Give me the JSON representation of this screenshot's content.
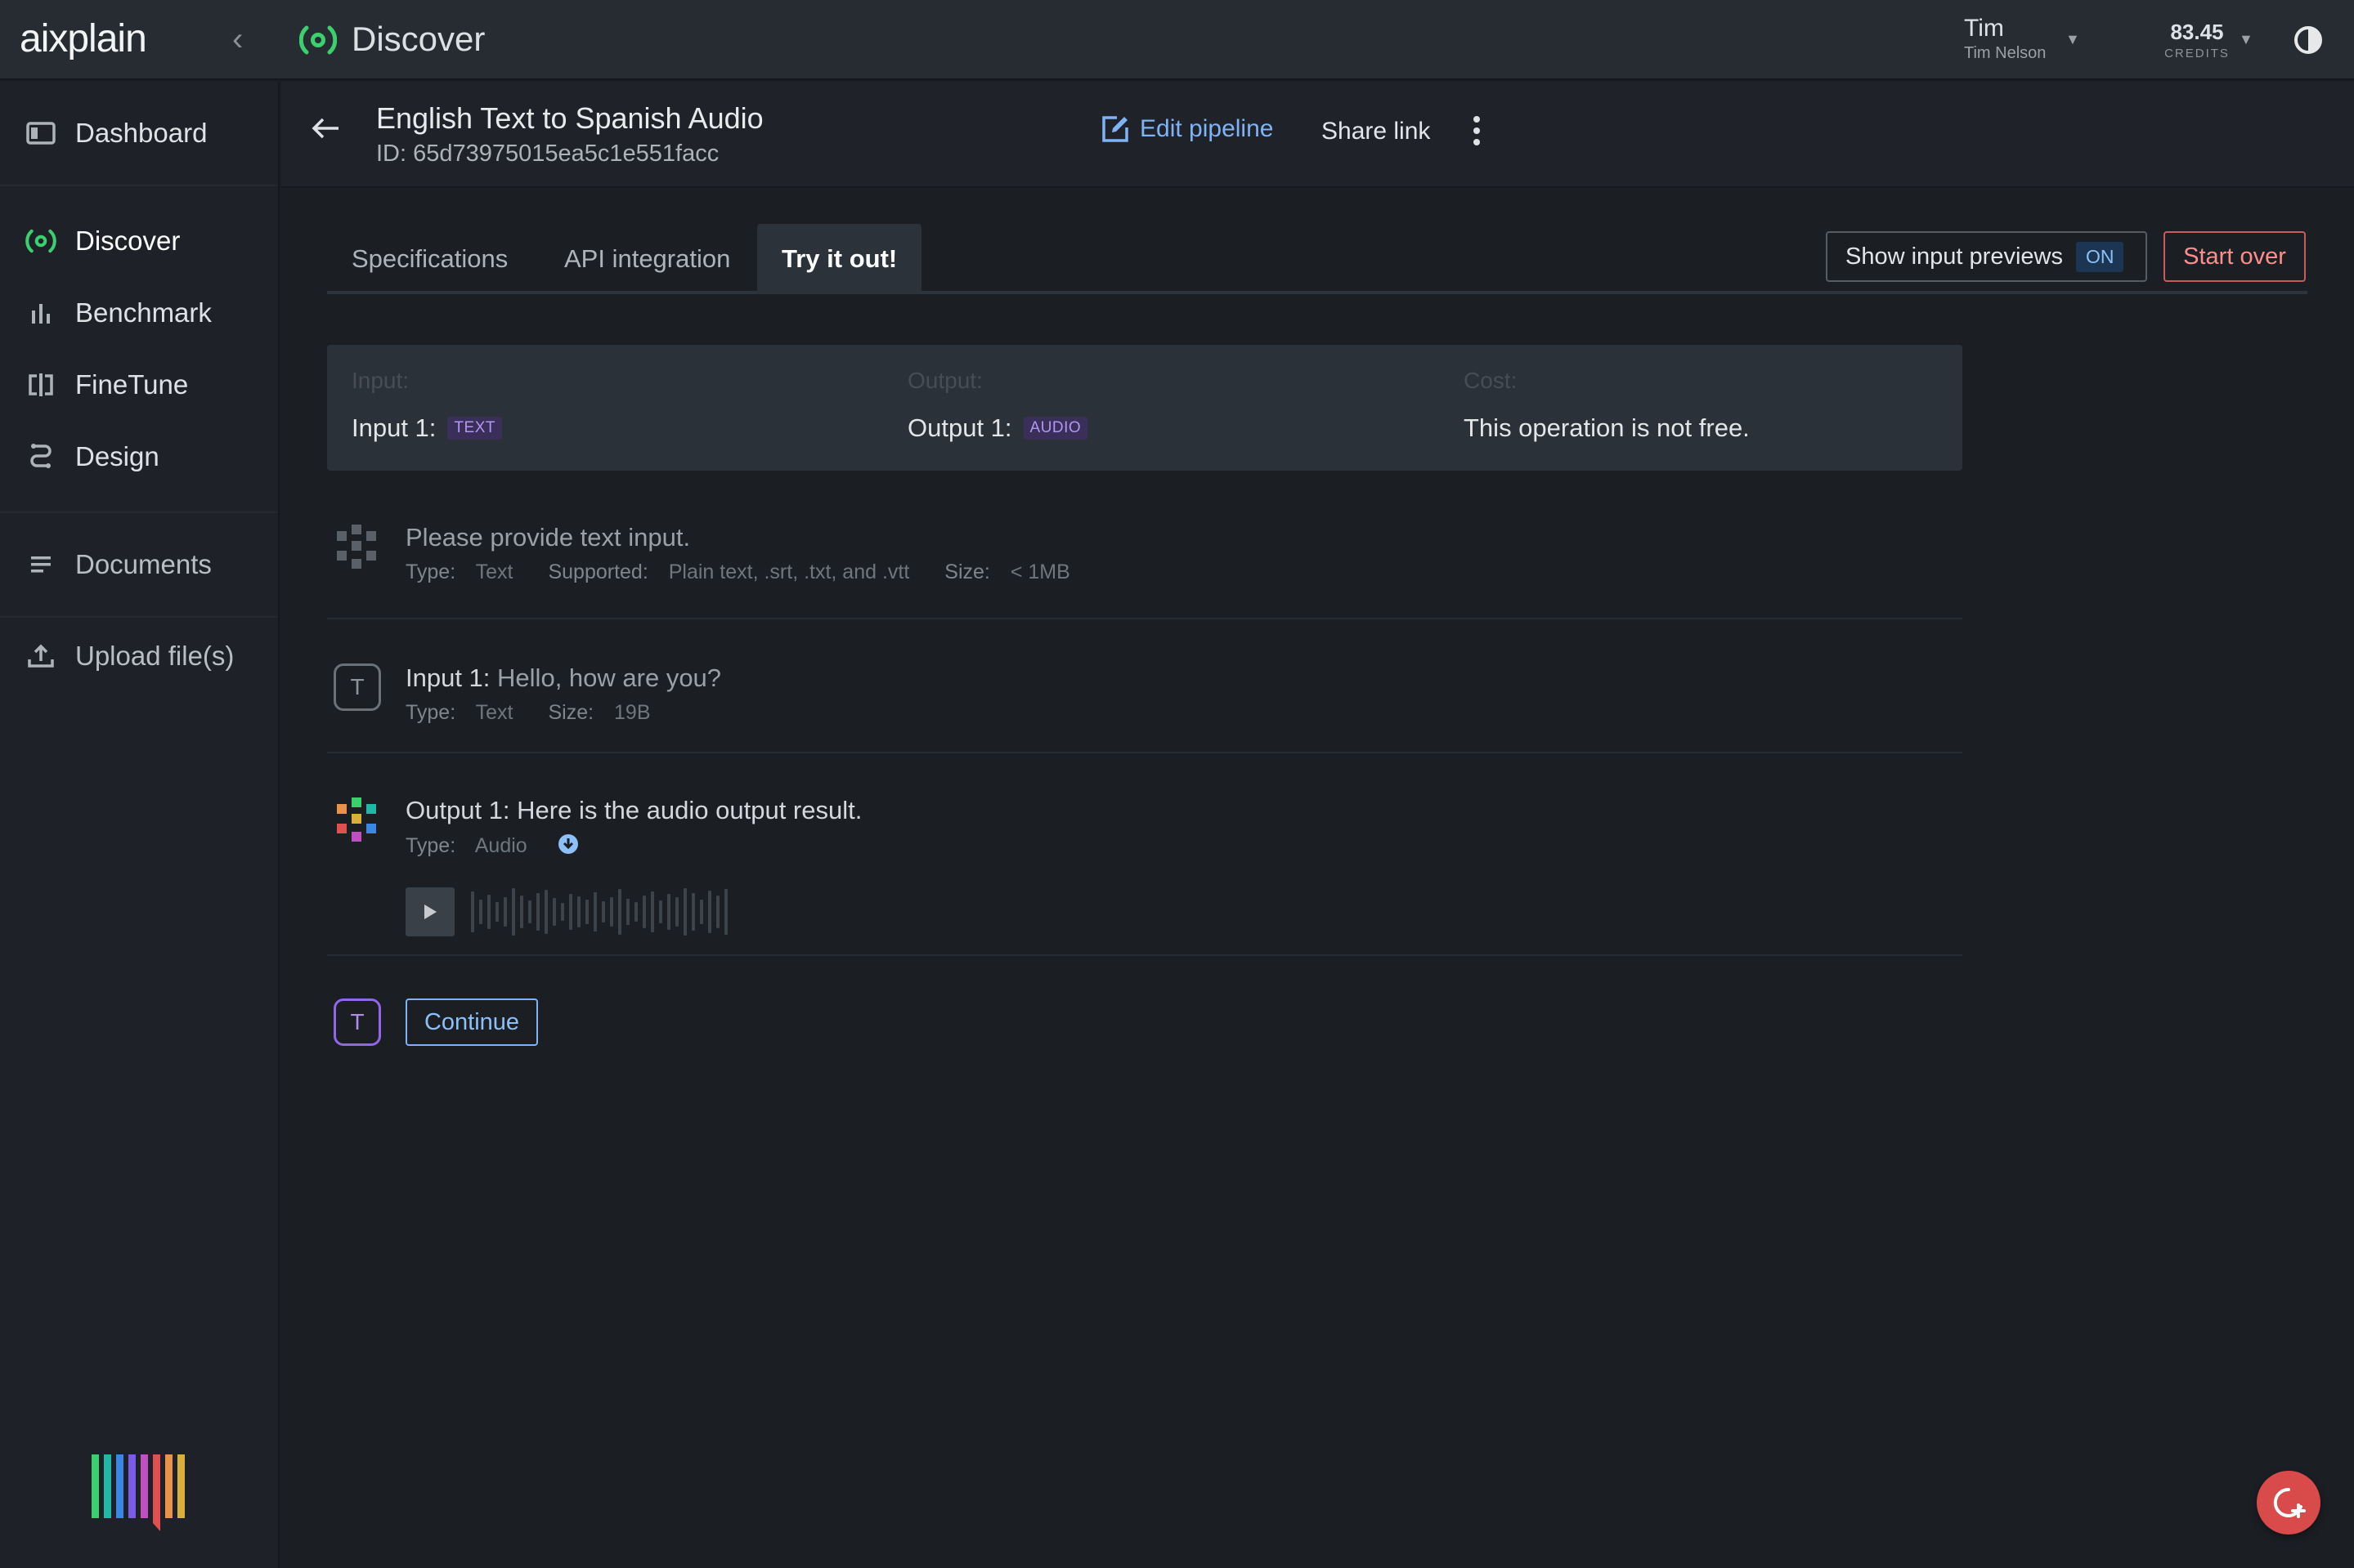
{
  "app": {
    "logo": "aixplain",
    "section_title": "Discover"
  },
  "user": {
    "name": "Tim",
    "full_name": "Tim Nelson"
  },
  "credits": {
    "value": "83.45",
    "label": "CREDITS"
  },
  "sidebar": {
    "items": [
      {
        "label": "Dashboard",
        "icon": "dashboard-icon"
      },
      {
        "label": "Discover",
        "icon": "discover-icon",
        "active": true
      },
      {
        "label": "Benchmark",
        "icon": "bar-chart-icon"
      },
      {
        "label": "FineTune",
        "icon": "finetune-icon"
      },
      {
        "label": "Design",
        "icon": "design-icon"
      },
      {
        "label": "Documents",
        "icon": "documents-icon"
      },
      {
        "label": "Upload file(s)",
        "icon": "upload-icon"
      }
    ]
  },
  "pipeline": {
    "title": "English Text to Spanish Audio",
    "id_text": "ID: 65d73975015ea5c1e551facc",
    "edit_label": "Edit pipeline",
    "share_label": "Share link"
  },
  "tabs": [
    {
      "label": "Specifications"
    },
    {
      "label": "API integration"
    },
    {
      "label": "Try it out!",
      "active": true
    }
  ],
  "controls": {
    "previews_label": "Show input previews",
    "previews_state": "ON",
    "start_over_label": "Start over"
  },
  "summary": {
    "input_label": "Input:",
    "input_value": "Input 1:",
    "input_tag": "TEXT",
    "output_label": "Output:",
    "output_value": "Output 1:",
    "output_tag": "AUDIO",
    "cost_label": "Cost:",
    "cost_value": "This operation is not free."
  },
  "prompt_row": {
    "text": "Please provide text input.",
    "type_key": "Type:",
    "type_val": "Text",
    "supported_key": "Supported:",
    "supported_val": "Plain text, .srt, .txt, and .vtt",
    "size_key": "Size:",
    "size_val": "< 1MB"
  },
  "input_row": {
    "badge": "T",
    "label": "Input 1:",
    "text": "Hello, how are you?",
    "type_key": "Type:",
    "type_val": "Text",
    "size_key": "Size:",
    "size_val": "19B"
  },
  "output_row": {
    "label": "Output 1:",
    "text": "Here is the audio output result.",
    "type_key": "Type:",
    "type_val": "Audio"
  },
  "continue_row": {
    "badge": "T",
    "button_label": "Continue"
  },
  "colors": {
    "accent_green": "#3ccf6e",
    "accent_blue": "#7fb3f5",
    "danger": "#ff8d8d",
    "tag_purple": "#b395f2"
  }
}
